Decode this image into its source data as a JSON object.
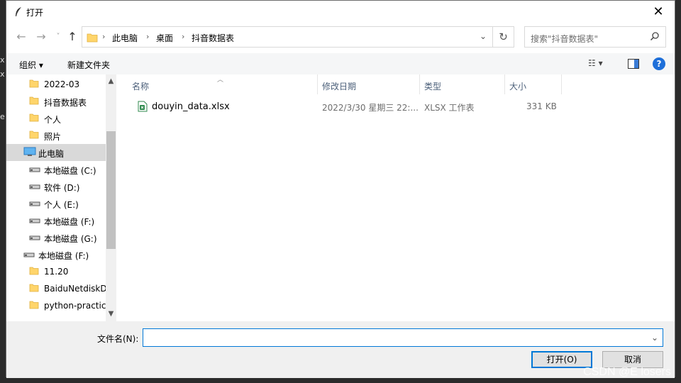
{
  "window": {
    "title": "打开",
    "close_glyph": "✕"
  },
  "nav": {
    "back_glyph": "←",
    "forward_glyph": "→",
    "recent_glyph": "˅",
    "up_glyph": "↑",
    "breadcrumb": [
      "此电脑",
      "桌面",
      "抖音数据表"
    ],
    "crumb_sep": "›",
    "refresh_glyph": "↻",
    "search_placeholder": "搜索\"抖音数据表\""
  },
  "toolbar": {
    "organize": "组织 ▾",
    "new_folder": "新建文件夹",
    "view_glyph": "☷ ▾",
    "help_glyph": "?"
  },
  "sidebar": {
    "items": [
      {
        "label": "2022-03",
        "icon": "folder-icon",
        "level": 2
      },
      {
        "label": "抖音数据表",
        "icon": "folder-icon",
        "level": 2
      },
      {
        "label": "个人",
        "icon": "folder-icon",
        "level": 2
      },
      {
        "label": "照片",
        "icon": "folder-icon",
        "level": 2
      },
      {
        "label": "此电脑",
        "icon": "computer-icon",
        "level": 1,
        "selected": true
      },
      {
        "label": "本地磁盘 (C:)",
        "icon": "drive-icon",
        "level": 2
      },
      {
        "label": "软件 (D:)",
        "icon": "drive-icon",
        "level": 2
      },
      {
        "label": "个人 (E:)",
        "icon": "drive-icon",
        "level": 2
      },
      {
        "label": "本地磁盘 (F:)",
        "icon": "drive-icon",
        "level": 2
      },
      {
        "label": "本地磁盘 (G:)",
        "icon": "drive-icon",
        "level": 2
      },
      {
        "label": "本地磁盘 (F:)",
        "icon": "drive-icon",
        "level": 1
      },
      {
        "label": "11.20",
        "icon": "folder-icon",
        "level": 2
      },
      {
        "label": "BaiduNetdiskD",
        "icon": "folder-icon",
        "level": 2
      },
      {
        "label": "python-practic",
        "icon": "folder-icon",
        "level": 2
      }
    ]
  },
  "columns": {
    "name": "名称",
    "modified": "修改日期",
    "type": "类型",
    "size": "大小"
  },
  "files": [
    {
      "name": "douyin_data.xlsx",
      "modified": "2022/3/30 星期三 22:...",
      "type": "XLSX 工作表",
      "size": "331 KB"
    }
  ],
  "footer": {
    "filename_label": "文件名(N):",
    "filename_value": "",
    "open_label": "打开(O)",
    "cancel_label": "取消"
  },
  "watermark": "CSDN @E losers",
  "colors": {
    "accent": "#0078d7",
    "folder": "#ffd56b",
    "excel": "#2f8a4e"
  }
}
